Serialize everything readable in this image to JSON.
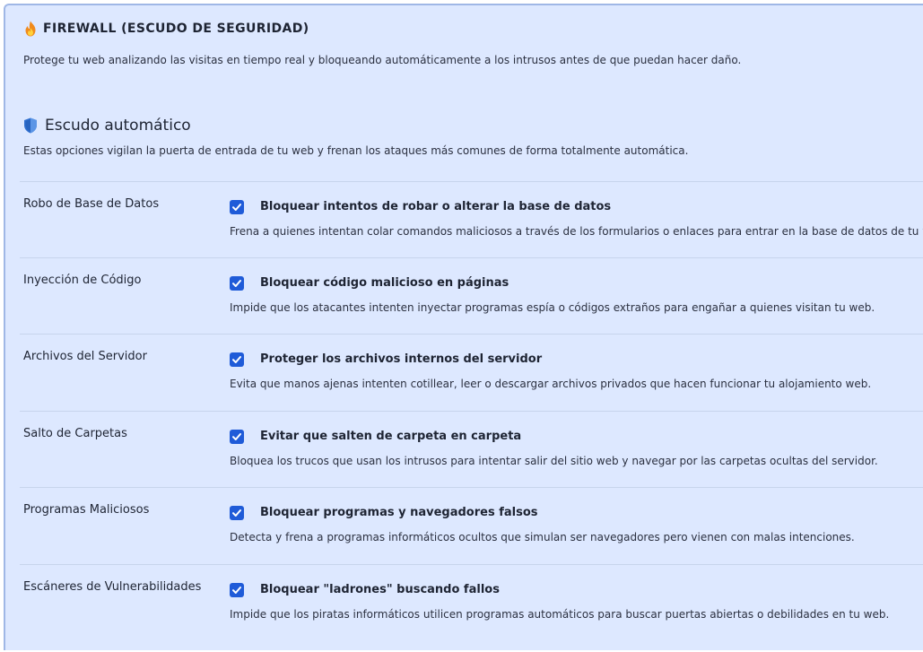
{
  "header": {
    "title": "FIREWALL (ESCUDO DE SEGURIDAD)",
    "description": "Protege tu web analizando las visitas en tiempo real y bloqueando automáticamente a los intrusos antes de que puedan hacer daño.",
    "icon": "fire-icon"
  },
  "section": {
    "title": "Escudo automático",
    "description": "Estas opciones vigilan la puerta de entrada de tu web y frenan los ataques más comunes de forma totalmente automática.",
    "icon": "shield-icon"
  },
  "colors": {
    "checkbox_accent": "#1f5bd8",
    "panel_background": "#dde8ff"
  },
  "options": [
    {
      "label": "Robo de Base de Datos",
      "option": "Bloquear intentos de robar o alterar la base de datos",
      "description": "Frena a quienes intentan colar comandos maliciosos a través de los formularios o enlaces para entrar en la base de datos de tu web.",
      "checked": true
    },
    {
      "label": "Inyección de Código",
      "option": "Bloquear código malicioso en páginas",
      "description": "Impide que los atacantes intenten inyectar programas espía o códigos extraños para engañar a quienes visitan tu web.",
      "checked": true
    },
    {
      "label": "Archivos del Servidor",
      "option": "Proteger los archivos internos del servidor",
      "description": "Evita que manos ajenas intenten cotillear, leer o descargar archivos privados que hacen funcionar tu alojamiento web.",
      "checked": true
    },
    {
      "label": "Salto de Carpetas",
      "option": "Evitar que salten de carpeta en carpeta",
      "description": "Bloquea los trucos que usan los intrusos para intentar salir del sitio web y navegar por las carpetas ocultas del servidor.",
      "checked": true
    },
    {
      "label": "Programas Maliciosos",
      "option": "Bloquear programas y navegadores falsos",
      "description": "Detecta y frena a programas informáticos ocultos que simulan ser navegadores pero vienen con malas intenciones.",
      "checked": true
    },
    {
      "label": "Escáneres de Vulnerabilidades",
      "option": "Bloquear \"ladrones\" buscando fallos",
      "description": "Impide que los piratas informáticos utilicen programas automáticos para buscar puertas abiertas o debilidades en tu web.",
      "checked": true
    }
  ]
}
